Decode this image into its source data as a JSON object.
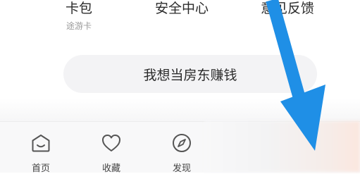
{
  "menu": {
    "items": [
      {
        "label": "卡包",
        "sub": "途游卡"
      },
      {
        "label": "安全中心"
      },
      {
        "label": "意见反馈"
      }
    ]
  },
  "host_button": {
    "label": "我想当房东赚钱"
  },
  "tabbar": {
    "tabs": [
      {
        "label": "首页",
        "icon": "home-icon"
      },
      {
        "label": "收藏",
        "icon": "heart-icon"
      },
      {
        "label": "发现",
        "icon": "compass-icon"
      }
    ]
  },
  "overlay": {
    "arrow_color": "#1f8fe6",
    "arrow_icon": "down-arrow-overlay"
  }
}
